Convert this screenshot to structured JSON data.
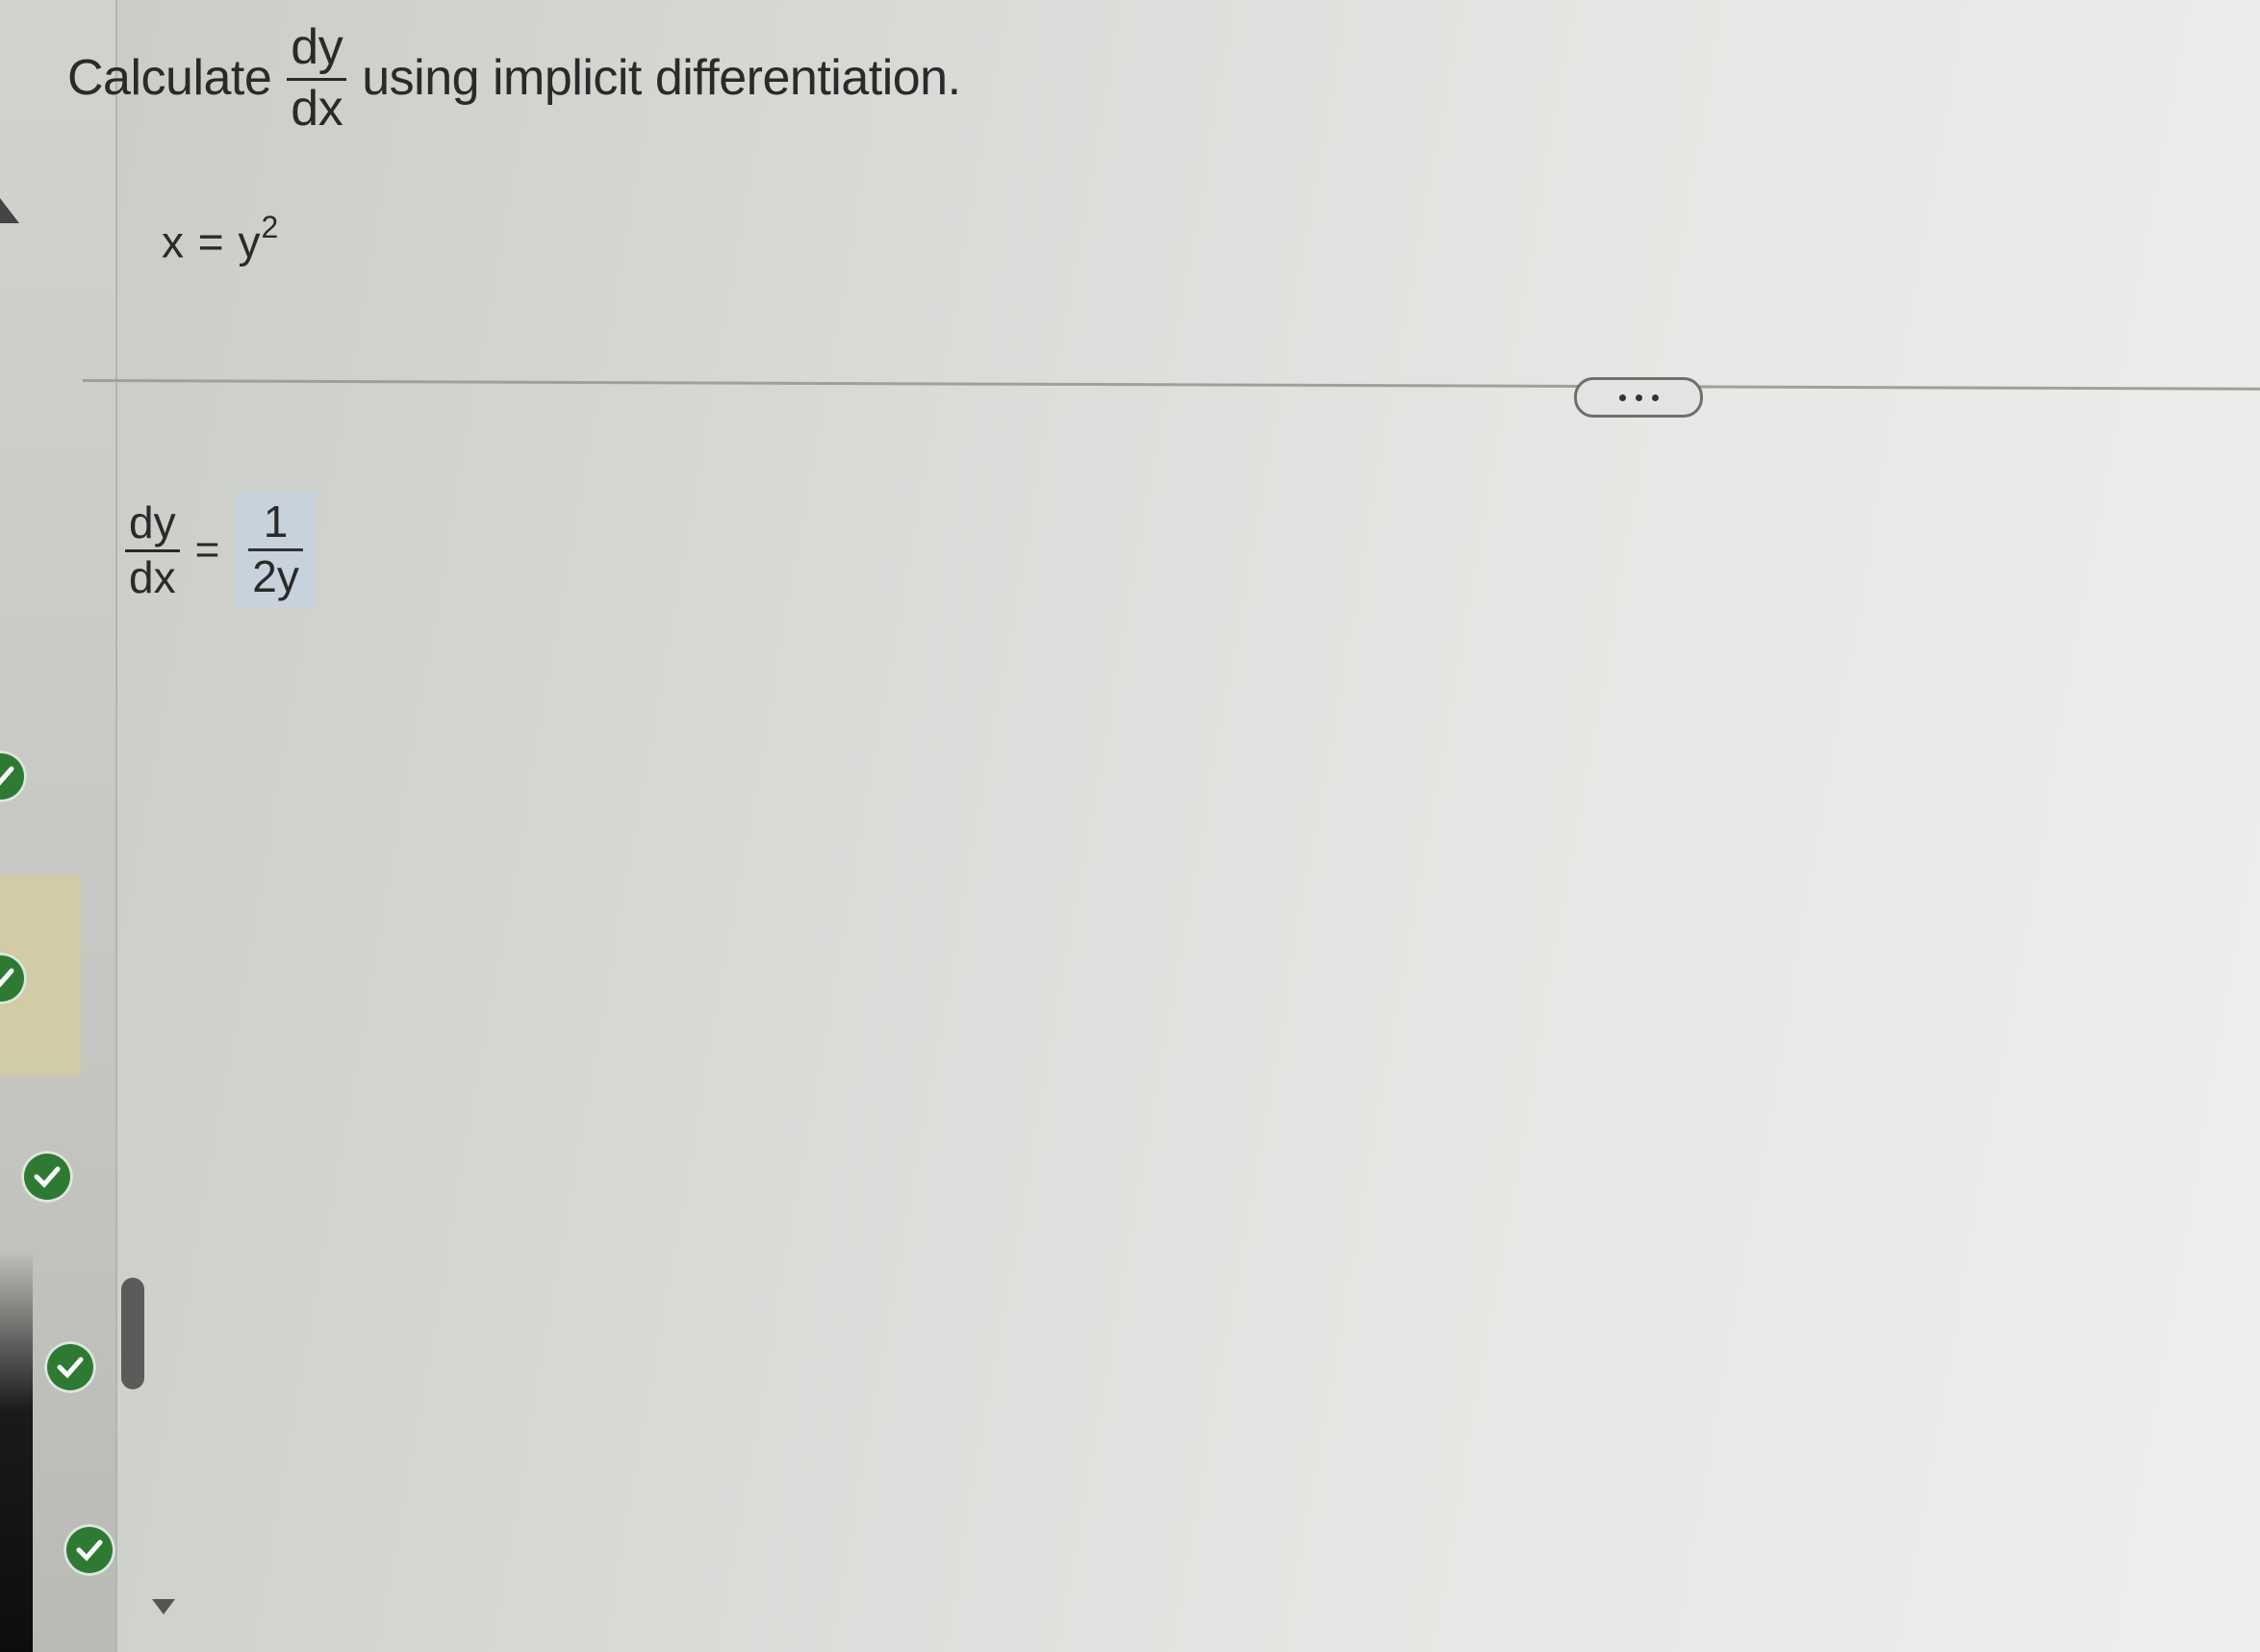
{
  "question": {
    "prefix": "Calculate",
    "fraction_num": "dy",
    "fraction_den": "dx",
    "suffix": "using implicit differentiation."
  },
  "equation": {
    "lhs": "x",
    "equals": "=",
    "base": "y",
    "exponent": "2"
  },
  "more_button": {
    "label": "..."
  },
  "answer": {
    "lhs_num": "dy",
    "lhs_den": "dx",
    "equals": "=",
    "rhs_num": "1",
    "rhs_den": "2y"
  },
  "sidebar": {
    "status_icons": [
      "check-icon",
      "check-icon",
      "check-icon",
      "check-icon",
      "check-icon"
    ],
    "status_color": "#2e7a32"
  }
}
